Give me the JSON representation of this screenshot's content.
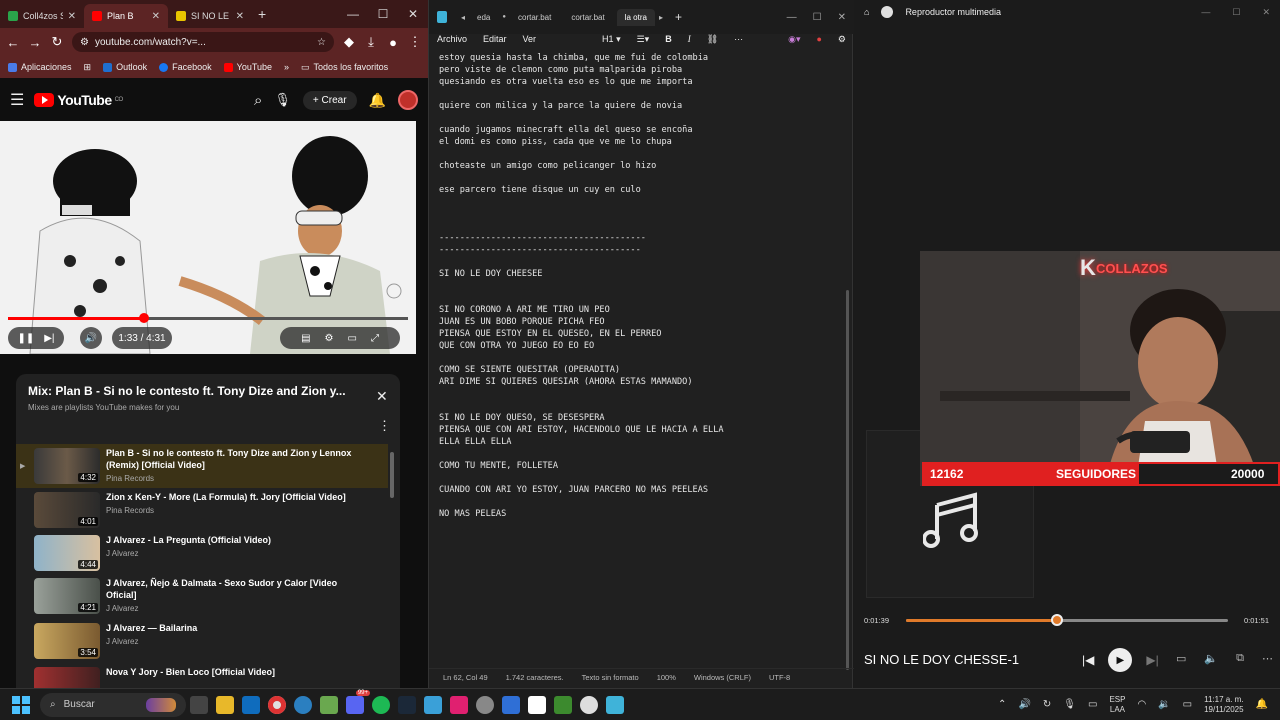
{
  "browser": {
    "tabs": [
      {
        "label": "Coll4zos S",
        "active": false
      },
      {
        "label": "Plan B",
        "active": true
      },
      {
        "label": "SI NO LE C",
        "active": false
      }
    ],
    "new_tab": "+",
    "url": "youtube.com/watch?v=...",
    "bookmarks": [
      "Aplicaciones",
      "Outlook",
      "Facebook",
      "YouTube",
      "Todos los favoritos"
    ],
    "bookmarks_more": "»",
    "youtube": {
      "logo": "YouTube",
      "country": "CO",
      "create_label": "Crear",
      "time": "1:33 / 4:31",
      "progress": 0.34,
      "mix_title": "Mix: Plan B - Si no le contesto ft. Tony Dize and Zion y...",
      "mix_subtitle": "Mixes are playlists YouTube makes for you",
      "playlist": [
        {
          "title": "Plan B - Si no le contesto ft. Tony Dize and Zion y Lennox (Remix) [Official Video]",
          "channel": "Pina Records",
          "duration": "4:32",
          "active": true
        },
        {
          "title": "Zion x Ken-Y - More (La Formula) ft. Jory [Official Video]",
          "channel": "Pina Records",
          "duration": "4:01",
          "active": false
        },
        {
          "title": "J Alvarez - La Pregunta (Official Video)",
          "channel": "J Alvarez",
          "duration": "4:44",
          "active": false
        },
        {
          "title": "J Alvarez, Ñejo & Dalmata - Sexo Sudor y Calor [Video Oficial]",
          "channel": "J Alvarez",
          "duration": "4:21",
          "active": false
        },
        {
          "title": "J Alvarez — Bailarina",
          "channel": "J Alvarez",
          "duration": "3:54",
          "active": false
        },
        {
          "title": "Nova Y Jory - Bien Loco [Official Video]",
          "channel": "",
          "duration": "",
          "active": false
        }
      ]
    }
  },
  "notepad": {
    "tabs": [
      "eda",
      "cortar.bat",
      "cortar.bat",
      "la otra"
    ],
    "new_tab": "+",
    "menu": [
      "Archivo",
      "Editar",
      "Ver"
    ],
    "heading_select": "H1",
    "text_lines": [
      "estoy quesia hasta la chimba, que me fui de colombia",
      "pero viste de clemon como puta malparida piroba",
      "quesiando es otra vuelta eso es lo que me importa",
      "",
      "quiere con milica y la parce la quiere de novia",
      "",
      "cuando jugamos minecraft ella del queso se encoña",
      "el domi es como piss, cada que ve me lo chupa",
      "",
      "choteaste un amigo como pelicanger lo hizo",
      "",
      "ese parcero tiene disque un cuy en culo",
      "",
      "",
      "",
      "----------------------------------------",
      "---------------------------------------",
      "",
      "SI NO LE DOY CHEESEE",
      "",
      "",
      "SI NO CORONO A ARI ME TIRO UN PEO",
      "JUAN ES UN BOBO PORQUE PICHA FEO",
      "PIENSA QUE ESTOY EN EL QUESEO, EN EL PERREO",
      "QUE CON OTRA YO JUEGO EO EO EO",
      "",
      "COMO SE SIENTE QUESITAR (OPERADITA)",
      "ARI DIME SI QUIERES QUESIAR (AHORA ESTAS MAMANDO)",
      "",
      "",
      "SI NO LE DOY QUESO, SE DESESPERA",
      "PIENSA QUE CON ARI ESTOY, HACENDOLO QUE LE HACIA A ELLA",
      "ELLA ELLA ELLA",
      "",
      "COMO TU MENTE, FOLLETEA",
      "",
      "CUANDO CON ARI YO ESTOY, JUAN PARCERO NO MAS PEELEAS",
      "",
      "NO MAS PELEAS"
    ],
    "status": {
      "position": "Ln 62, Col 49",
      "chars": "1.742 caracteres.",
      "format": "Texto sin formato",
      "zoom": "100%",
      "eol": "Windows (CRLF)",
      "encoding": "UTF-8"
    }
  },
  "player": {
    "title": "Reproductor multimedia",
    "overlay_brand": "COLLAZOS",
    "followers_current": "12162",
    "followers_label": "SEGUIDORES",
    "followers_goal": "20000",
    "followers_fraction": 0.608,
    "elapsed": "0:01:39",
    "remaining": "0:01:51",
    "seek": 0.47,
    "track_title": "SI NO LE DOY CHESSE-1"
  },
  "taskbar": {
    "search_placeholder": "Buscar",
    "lang": "ESP",
    "lang_sub": "LAA",
    "time": "11:17 a. m.",
    "date": "19/11/2025",
    "badge": "99+"
  },
  "colors": {
    "accent_red": "#e02020",
    "browser_tab": "#5c2424",
    "seek": "#e07a2a"
  }
}
